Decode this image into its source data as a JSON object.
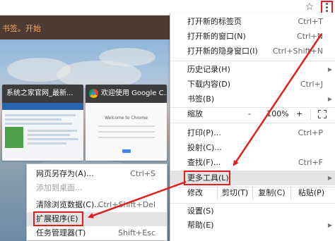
{
  "toolbar": {
    "star_icon": "star-icon",
    "menu_icon": "more-vertical-icon"
  },
  "bookbar": {
    "text": "书签。开始"
  },
  "thumbnails": [
    {
      "title": "系统之家官网_最新..."
    },
    {
      "title": "欢迎使用 Google C...",
      "welcome_text": "Welcome to Chrome"
    }
  ],
  "menu": {
    "new_tab": {
      "label": "打开新的标签页",
      "shortcut": "Ctrl+T"
    },
    "new_window": {
      "label": "打开新的窗口(N)",
      "shortcut": "Ctrl+N"
    },
    "incognito": {
      "label": "打开新的隐身窗口(I)",
      "shortcut": "Ctrl+Shift+N"
    },
    "history": {
      "label": "历史记录(H)"
    },
    "downloads": {
      "label": "下载内容(D)",
      "shortcut": "Ctrl+J"
    },
    "bookmarks": {
      "label": "书签(B)"
    },
    "zoom": {
      "label": "缩放",
      "minus": "-",
      "value": "100%",
      "plus": "+"
    },
    "print": {
      "label": "打印(P)...",
      "shortcut": "Ctrl+P"
    },
    "cast": {
      "label": "投射(C)..."
    },
    "find": {
      "label": "查找(F)...",
      "shortcut": "Ctrl+F"
    },
    "more_tools": {
      "label": "更多工具(L)"
    },
    "edit": {
      "label": "修改",
      "cut": "剪切(T)",
      "copy": "复制(C)",
      "paste": "粘贴(P)"
    },
    "settings": {
      "label": "设置(S)"
    },
    "help": {
      "label": "帮助(E)"
    }
  },
  "submenu": {
    "save_as": {
      "label": "网页另存为(A)...",
      "shortcut": "Ctrl+S"
    },
    "add_to_desktop": {
      "label": "添加到桌面..."
    },
    "clear_data": {
      "label": "清除浏览数据(C)...",
      "shortcut": "Ctrl+Shift+Del"
    },
    "extensions": {
      "label": "扩展程序(E)"
    },
    "task_manager": {
      "label": "任务管理器(T)",
      "shortcut": "Shift+Esc"
    }
  },
  "colors": {
    "annotation_red": "#e02020",
    "menu_highlight": "#e4e4e4"
  }
}
